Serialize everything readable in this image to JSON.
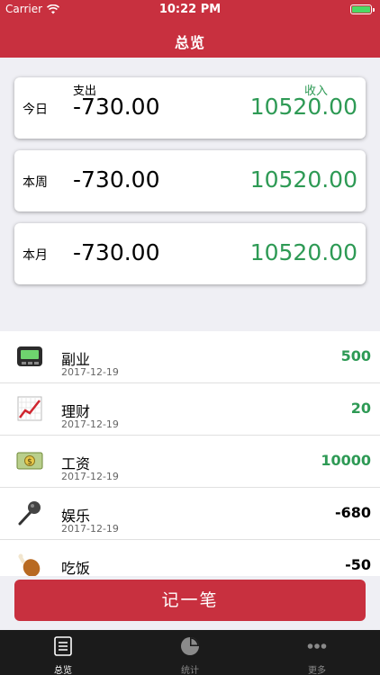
{
  "status": {
    "carrier": "Carrier",
    "time": "10:22 PM"
  },
  "nav": {
    "title": "总览"
  },
  "labels": {
    "expense": "支出",
    "income": "收入"
  },
  "summary": [
    {
      "period": "今日",
      "expense": "-730.00",
      "income": "10520.00"
    },
    {
      "period": "本周",
      "expense": "-730.00",
      "income": "10520.00"
    },
    {
      "period": "本月",
      "expense": "-730.00",
      "income": "10520.00"
    }
  ],
  "transactions": [
    {
      "category": "副业",
      "date": "2017-12-19",
      "amount": "500",
      "icon": "pager-icon",
      "color": "#2e9a55"
    },
    {
      "category": "理财",
      "date": "2017-12-19",
      "amount": "20",
      "icon": "chart-increasing-icon",
      "color": "#2e9a55"
    },
    {
      "category": "工资",
      "date": "2017-12-19",
      "amount": "10000",
      "icon": "dollar-banknote-icon",
      "color": "#2e9a55"
    },
    {
      "category": "娱乐",
      "date": "2017-12-19",
      "amount": "-680",
      "icon": "microphone-icon",
      "color": "#000000"
    },
    {
      "category": "吃饭",
      "date": "",
      "amount": "-50",
      "icon": "poultry-leg-icon",
      "color": "#000000"
    }
  ],
  "add_button": "记一笔",
  "tabs": [
    {
      "label": "总览",
      "icon": "list-icon",
      "active": true
    },
    {
      "label": "统计",
      "icon": "pie-chart-icon",
      "active": false
    },
    {
      "label": "更多",
      "icon": "more-dots-icon",
      "active": false
    }
  ],
  "colors": {
    "accent": "#c8303f",
    "income": "#2e9a55",
    "tabbar": "#1b1b1b"
  }
}
